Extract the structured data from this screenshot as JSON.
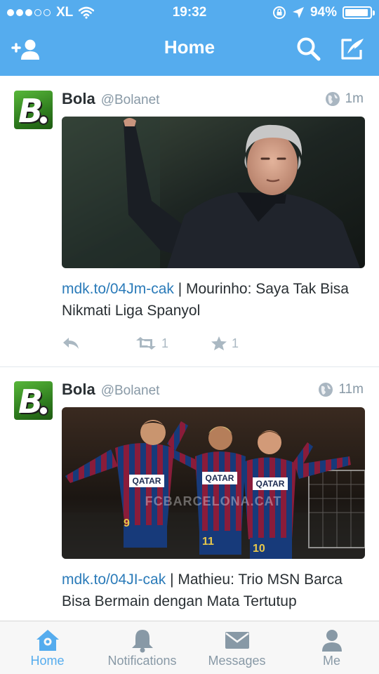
{
  "status_bar": {
    "carrier": "XL",
    "time": "19:32",
    "battery": "94%",
    "battery_level": 0.94
  },
  "nav": {
    "title": "Home",
    "add_user_icon": "add-user-icon",
    "search_icon": "search-icon",
    "compose_icon": "compose-icon"
  },
  "tweets": [
    {
      "name": "Bola",
      "handle": "@Bolanet",
      "time": "1m",
      "link": "mdk.to/04Jm-cak",
      "text": " | Mourinho: Saya Tak Bisa Nikmati Liga Spanyol",
      "retweets": "1",
      "favorites": "1"
    },
    {
      "name": "Bola",
      "handle": "@Bolanet",
      "time": "11m",
      "link": "mdk.to/04JI-cak",
      "text": " | Mathieu: Trio MSN Barca Bisa Bermain dengan Mata Tertutup",
      "watermark": "FCBARCELONA.CAT",
      "jersey_sponsor": "QATAR",
      "jersey_sub": "AIRWAYS"
    }
  ],
  "tabbar": {
    "tabs": [
      {
        "label": "Home",
        "icon": "home-icon"
      },
      {
        "label": "Notifications",
        "icon": "bell-icon"
      },
      {
        "label": "Messages",
        "icon": "envelope-icon"
      },
      {
        "label": "Me",
        "icon": "person-icon"
      }
    ]
  },
  "colors": {
    "brand": "#55acee",
    "link": "#2b7bb9",
    "muted": "#8899a6"
  }
}
